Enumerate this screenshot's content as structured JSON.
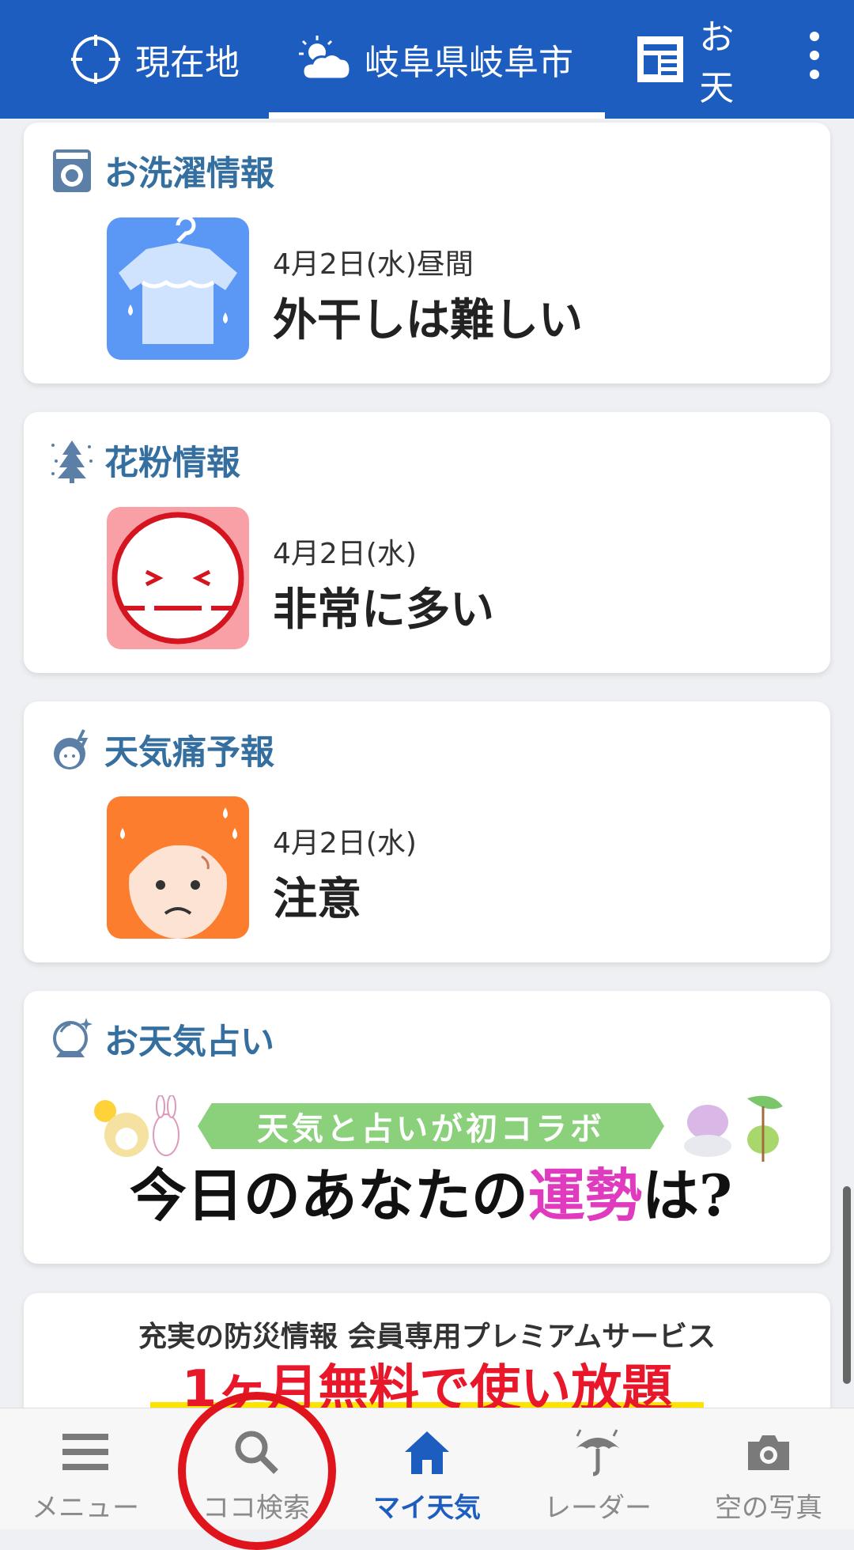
{
  "header": {
    "tabs": [
      {
        "label": "現在地",
        "icon": "crosshair-icon"
      },
      {
        "label": "岐阜県岐阜市",
        "icon": "partly-cloudy-icon",
        "selected": true
      },
      {
        "label": "お天",
        "icon": "news-icon"
      }
    ],
    "menu_icon": "kebab-menu-icon",
    "colors": {
      "bar": "#1d5dbf"
    }
  },
  "cards": {
    "laundry": {
      "title": "お洗濯情報",
      "icon": "washing-machine-icon",
      "image": "wet-shirt-icon",
      "date": "4月2日(水)昼間",
      "status": "外干しは難しい"
    },
    "pollen": {
      "title": "花粉情報",
      "icon": "pollen-tree-icon",
      "image": "sneezing-face-icon",
      "date": "4月2日(水)",
      "status": "非常に多い"
    },
    "headache": {
      "title": "天気痛予報",
      "icon": "headache-face-icon",
      "image": "worried-face-icon",
      "date": "4月2日(水)",
      "status": "注意"
    },
    "fortune": {
      "title": "お天気占い",
      "icon": "crystal-ball-icon",
      "banner_tag": "天気と占いが初コラボ",
      "banner_main_a": "今日のあなたの",
      "banner_main_b": "運勢",
      "banner_main_c": "は?"
    }
  },
  "promo": {
    "line1": "充実の防災情報 会員専用プレミアムサービス",
    "line2": "1ヶ月無料で使い放題"
  },
  "bottom_nav": [
    {
      "label": "メニュー",
      "icon": "hamburger-icon"
    },
    {
      "label": "ココ検索",
      "icon": "search-icon"
    },
    {
      "label": "マイ天気",
      "icon": "home-icon",
      "active": true
    },
    {
      "label": "レーダー",
      "icon": "umbrella-icon"
    },
    {
      "label": "空の写真",
      "icon": "camera-icon"
    }
  ]
}
